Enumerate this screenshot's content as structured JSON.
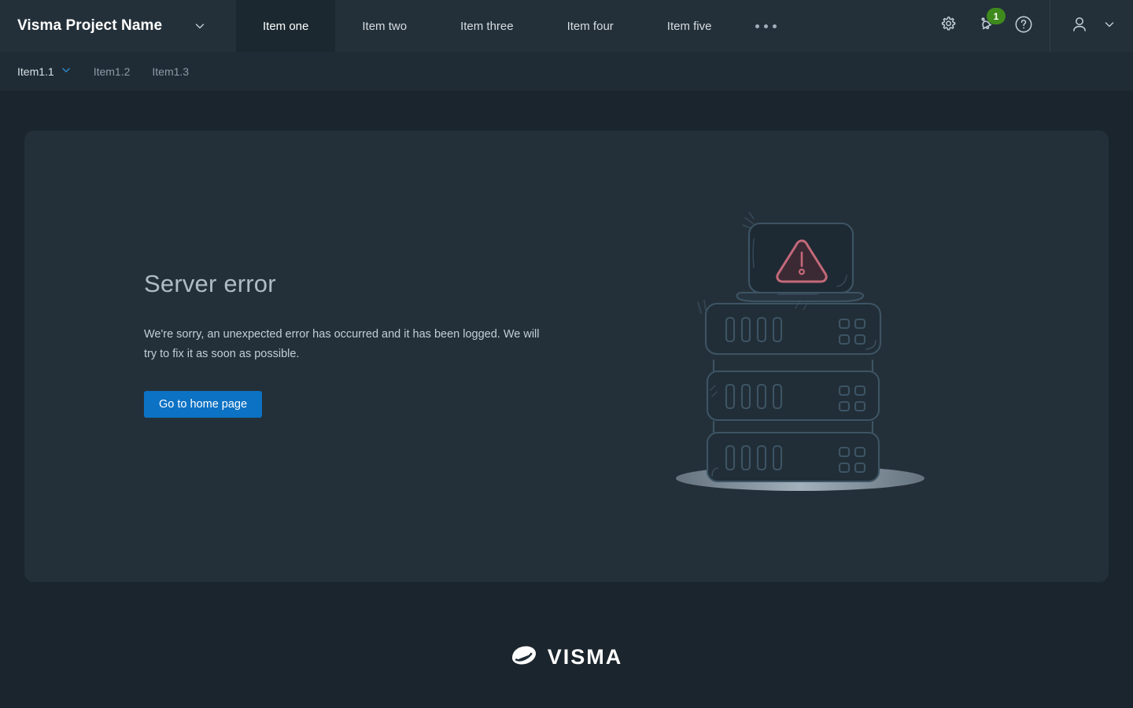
{
  "header": {
    "brand_title": "Visma Project Name",
    "brand_caret_icon": "chevron-down-icon",
    "tabs": [
      {
        "label": "Item one",
        "active": true
      },
      {
        "label": "Item two",
        "active": false
      },
      {
        "label": "Item three",
        "active": false
      },
      {
        "label": "Item four",
        "active": false
      },
      {
        "label": "Item five",
        "active": false
      }
    ],
    "overflow_icon": "ellipsis-icon",
    "actions": [
      {
        "icon": "gear-icon",
        "label": "Settings"
      },
      {
        "icon": "bell-icon",
        "label": "Notifications",
        "badge": "1"
      },
      {
        "icon": "help-circle-icon",
        "label": "Help"
      }
    ],
    "notification_badge": "1",
    "user": {
      "avatar_icon": "user-avatar-icon",
      "caret_icon": "chevron-down-icon"
    }
  },
  "subnav": {
    "items": [
      {
        "label": "Item1.1",
        "active": true,
        "caret_icon": "chevron-down-icon"
      },
      {
        "label": "Item1.2",
        "active": false
      },
      {
        "label": "Item1.3",
        "active": false
      }
    ]
  },
  "main": {
    "error_title": "Server error",
    "error_body": "We're sorry, an unexpected error has occurred and it has been logged. We will try to fix it as soon as possible.",
    "home_button_label": "Go to home page",
    "illustration": "server-stack-error-illustration"
  },
  "footer": {
    "logo_mark_icon": "visma-leaf-icon",
    "logo_text": "VISMA"
  },
  "colors": {
    "page_bg": "#1a252d",
    "header_bg": "#243039",
    "active_tab_bg": "#1b2830",
    "subnav_bg": "#202c35",
    "card_bg": "#243039",
    "accent_blue": "#0c72c4",
    "badge_green": "#3e8a1d",
    "warning_red": "#c4697a",
    "title_text": "#aebcc6",
    "body_text": "#c3ced6"
  }
}
